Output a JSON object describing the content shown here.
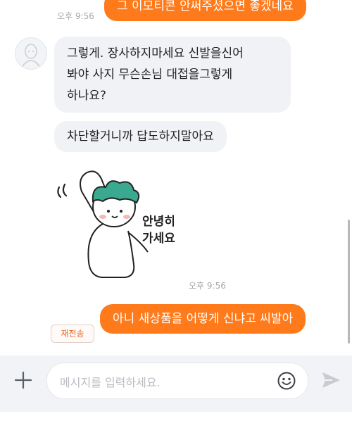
{
  "messages": {
    "top_outgoing": "그 이모티콘 안써주셨으면 좋겠네요",
    "top_time": "오후 9:56",
    "incoming_1": [
      "그렇게. 장사하지마세요 신발을신어",
      "봐야 사지 무슨손님 대접을그렇게",
      "하나요?"
    ],
    "incoming_2": "차단할거니까 답도하지말아요",
    "sticker_text": [
      "안녕히",
      "가세요"
    ],
    "sticker_time": "오후 9:56",
    "outgoing_last": "아니 새상품을 어떻게 신냐고 씨발아",
    "resend_label": "재전송"
  },
  "composer": {
    "placeholder": "메시지를 입력하세요."
  },
  "icons": {
    "add": "plus-icon",
    "emoji": "smiley-icon",
    "send": "send-icon",
    "avatar": "default-profile-avatar"
  },
  "colors": {
    "outgoing_bubble": "#ff7a1a",
    "incoming_bubble": "#f1f2f6",
    "resend_text": "#e06b2a"
  }
}
